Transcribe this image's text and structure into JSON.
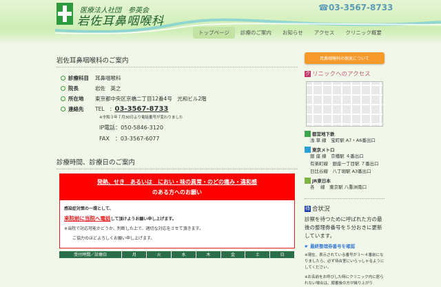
{
  "header": {
    "corp": "医療法人社団　参英会",
    "clinic": "岩佐耳鼻咽喉科",
    "tel": "☎03-3567-8733"
  },
  "nav": [
    "トップページ",
    "診療のご案内",
    "お知らせ",
    "アクセス",
    "クリニック概要"
  ],
  "info": {
    "title": "岩佐耳鼻咽喉科のご案内",
    "rows": [
      {
        "label": "診療科目",
        "value": "耳鼻咽喉科"
      },
      {
        "label": "院長",
        "value": "岩佐　英之"
      },
      {
        "label": "所在地",
        "value": "東京都中央区京橋二丁目12番4号　光和ビル2階"
      },
      {
        "label": "連絡先",
        "value": "TEL　："
      }
    ],
    "tel": "03-3567-8733",
    "note": "※令和３年７月30日より電話番号が変わりました",
    "ip": "IP電話：050-5846-3120",
    "fax": "FAX　：03-3567-6077"
  },
  "hours": {
    "title": "診療時間、診療日のご案内",
    "notice_line1": "発熱、せき　あるいは　におい・味の異常・のどの痛み・違和感",
    "notice_line2": "のある方へのお願い",
    "body1": "感染症対策の一環として、",
    "body2_red": "来院前に当院へ電話",
    "body2": "して頂けようお願い申し上げます。",
    "body3": "※当院で対応可能かどうか、判断した上で、適切な対応をさせて頂きます。",
    "body4": "ご協力のほどよろしくお願い申し上げます。",
    "table_head": [
      "受付時間／診療日",
      "月",
      "火",
      "水",
      "木",
      "金",
      "土",
      "日"
    ]
  },
  "side": {
    "button": "耳鼻咽喉科の病気について",
    "access_icon": "ク",
    "access": "リニックへのアクセス",
    "lines": [
      {
        "name": "都営地下鉄",
        "color": "#3aa54a",
        "stations": [
          "浅 草 線　宝町駅 A7・A6番出口"
        ]
      },
      {
        "name": "東京メトロ",
        "color": "#2a9fd6",
        "stations": [
          "銀 座 線　京橋駅 ４番出口",
          "有楽町線　銀座一丁目駅 ７番出口",
          "日比谷線　八丁堀駅 A3番出口"
        ]
      },
      {
        "name": "JR東日本",
        "color": "#7cb342",
        "stations": [
          "各　 線　東京駅 八重洲南口"
        ]
      }
    ],
    "wait_icon": "待",
    "wait_title": "合状況",
    "wait_text": "診察を待つために呼ばれた方の最後の整理券番号を５分おきに更新しています。",
    "wait_link": "☛ 最終整理券番号を確認",
    "note1": "※現在、表示されている番号が３～４番前になりましたら、必ず待合室にいらっしゃるようにしてください。",
    "note2": "※お名前をお呼びした時にクリニック内に居られない場合は、順番後の方が繰り上がり"
  }
}
